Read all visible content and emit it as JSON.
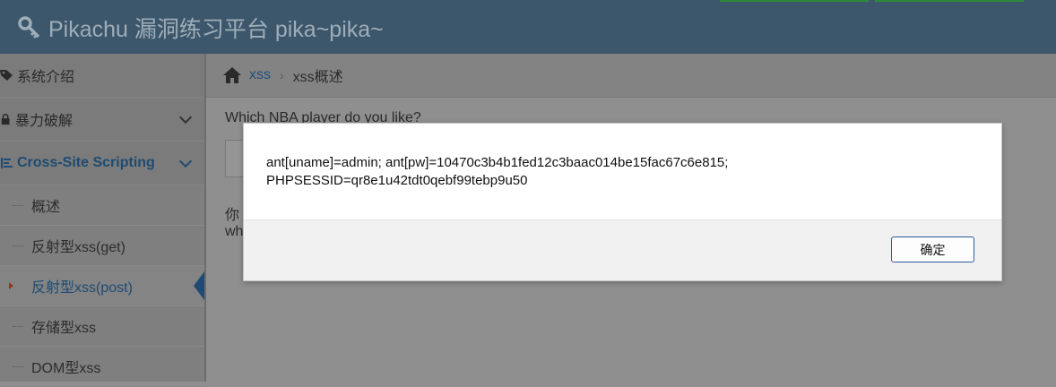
{
  "header": {
    "title": "Pikachu 漏洞练习平台 pika~pika~",
    "icon": "key-icon"
  },
  "sidebar": {
    "items": [
      {
        "label": "系统介绍",
        "icon": "tags-icon"
      },
      {
        "label": "暴力破解",
        "icon": "lock-icon"
      },
      {
        "label": "Cross-Site Scripting",
        "icon": "list-icon"
      }
    ],
    "subitems": [
      {
        "label": "概述"
      },
      {
        "label": "反射型xss(get)"
      },
      {
        "label": "反射型xss(post)"
      },
      {
        "label": "存储型xss"
      },
      {
        "label": "DOM型xss"
      }
    ]
  },
  "breadcrumb": {
    "home_icon": "home-icon",
    "link": "xss",
    "separator": "›",
    "current": "xss概述"
  },
  "main": {
    "question": "Which NBA player do you like?",
    "result_line1": "你",
    "result_line2": "wh"
  },
  "dialog": {
    "message_line1": "ant[uname]=admin; ant[pw]=10470c3b4b1fed12c3baac014be15fac67c6e815;",
    "message_line2": "PHPSESSID=qr8e1u42tdt0qebf99tebp9u50",
    "ok_label": "确定"
  },
  "colors": {
    "navbar": "#3c566b",
    "accent_link": "#1f4e78",
    "dialog_button_border": "#2a5c9a"
  }
}
